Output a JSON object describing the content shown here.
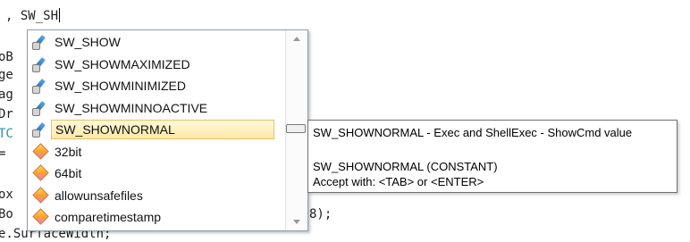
{
  "editor": {
    "lines": [
      ", SW_SH",
      "oB",
      "ge",
      "ag",
      "Dr",
      "TC",
      "=",
      "ox",
      "Bo",
      "8);",
      "e.SurfaceWidth;"
    ]
  },
  "autocomplete": {
    "items": [
      {
        "label": "SW_SHOW",
        "icon": "constant-icon"
      },
      {
        "label": "SW_SHOWMAXIMIZED",
        "icon": "constant-icon"
      },
      {
        "label": "SW_SHOWMINIMIZED",
        "icon": "constant-icon"
      },
      {
        "label": "SW_SHOWMINNOACTIVE",
        "icon": "constant-icon"
      },
      {
        "label": "SW_SHOWNORMAL",
        "icon": "constant-icon",
        "selected": true
      },
      {
        "label": "32bit",
        "icon": "keyword-icon"
      },
      {
        "label": "64bit",
        "icon": "keyword-icon"
      },
      {
        "label": "allowunsafefiles",
        "icon": "keyword-icon"
      },
      {
        "label": "comparetimestamp",
        "icon": "keyword-icon"
      }
    ]
  },
  "tooltip": {
    "title": "SW_SHOWNORMAL - Exec and ShellExec - ShowCmd value",
    "name": "SW_SHOWNORMAL (CONSTANT)",
    "accept": "Accept with: <TAB> or <ENTER>"
  },
  "colors": {
    "selection_bg": "#ffe9a8",
    "selection_border": "#e5c365",
    "keyword_text": "#2b91af"
  }
}
